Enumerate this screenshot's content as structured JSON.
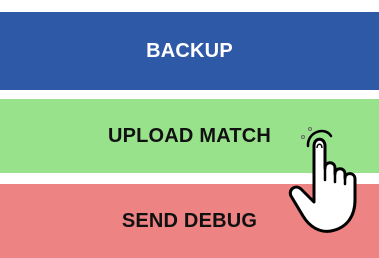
{
  "buttons": {
    "backup": {
      "label": "BACKUP",
      "color": "#2e59a7",
      "text_color": "#ffffff"
    },
    "upload_match": {
      "label": "UPLOAD MATCH",
      "color": "#99e28c",
      "text_color": "#111111"
    },
    "send_debug": {
      "label": "SEND DEBUG",
      "color": "#ee8383",
      "text_color": "#111111"
    }
  },
  "overlay": {
    "icon": "tap-hand-icon",
    "target": "upload_match"
  }
}
